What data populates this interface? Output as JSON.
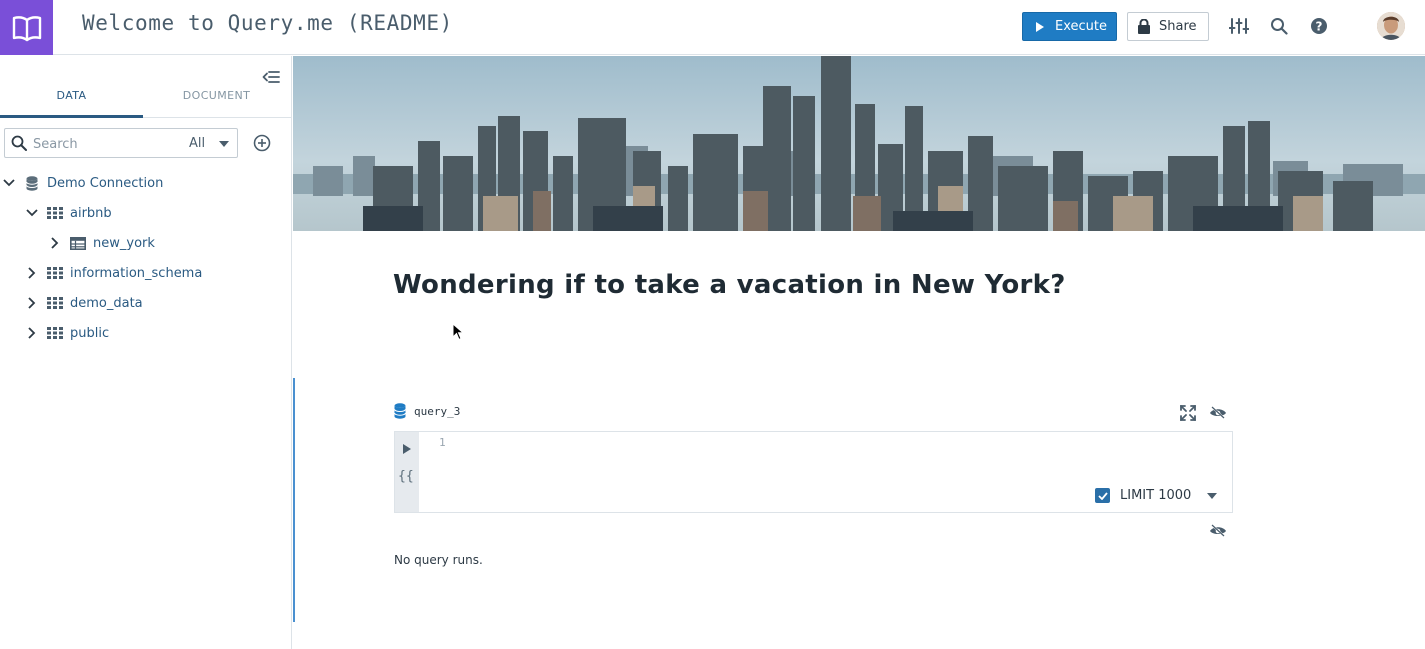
{
  "header": {
    "title": "Welcome to Query.me (README)",
    "execute_label": "Execute",
    "share_label": "Share",
    "icons": [
      "book-icon",
      "sliders-icon",
      "search-icon",
      "help-icon",
      "avatar"
    ]
  },
  "colors": {
    "brand": "#7a4fd8",
    "primary": "#1f7cc4",
    "link": "#2a5a82"
  },
  "sidebar": {
    "tabs": [
      {
        "label": "DATA",
        "active": true
      },
      {
        "label": "DOCUMENT",
        "active": false
      }
    ],
    "search": {
      "placeholder": "Search",
      "scope": "All"
    },
    "tree": [
      {
        "label": "Demo Connection",
        "type": "connection",
        "expanded": true
      },
      {
        "label": "airbnb",
        "type": "schema",
        "expanded": true
      },
      {
        "label": "new_york",
        "type": "table",
        "expanded": false
      },
      {
        "label": "information_schema",
        "type": "schema",
        "expanded": false
      },
      {
        "label": "demo_data",
        "type": "schema",
        "expanded": false
      },
      {
        "label": "public",
        "type": "schema",
        "expanded": false
      }
    ]
  },
  "main": {
    "heading": "Wondering if to take a vacation in New York?",
    "query": {
      "name": "query_3",
      "line_number": "1",
      "template_glyph": "{{",
      "limit_label": "LIMIT 1000",
      "limit_checked": true
    },
    "status_text": "No query runs."
  }
}
